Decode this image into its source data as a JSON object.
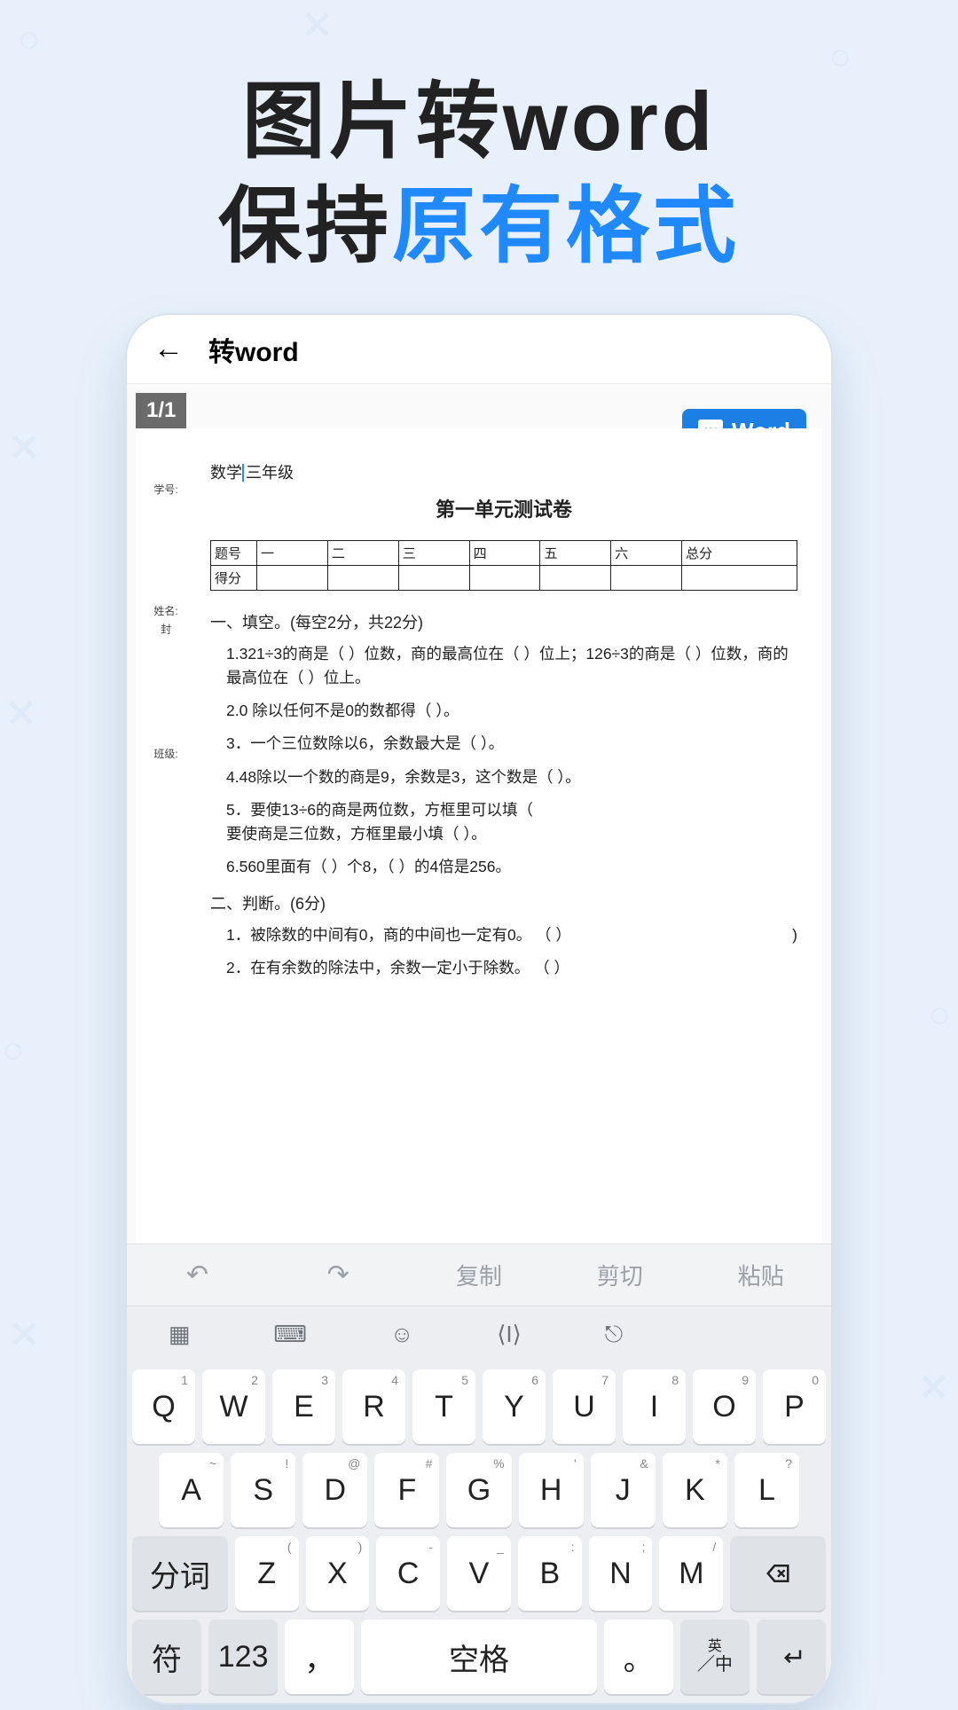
{
  "hero": {
    "line1": "图片转word",
    "line2a": "保持",
    "line2b": "原有格式"
  },
  "app": {
    "title": "转word",
    "page_indicator": "1/1",
    "word_button": "Word"
  },
  "paper": {
    "side_labels": {
      "xuehao": "学号:",
      "xingming": "姓名:",
      "feng": "封",
      "banji": "班级:"
    },
    "subject_prefix": "数学",
    "subject_suffix": "三年级",
    "title": "第一单元测试卷",
    "table": {
      "row1": [
        "题号",
        "一",
        "二",
        "三",
        "四",
        "五",
        "六",
        "总分"
      ],
      "row2_label": "得分"
    },
    "section1": "一、填空。(每空2分，共22分)",
    "q": {
      "q1": "1.321÷3的商是（  ）位数，商的最高位在（  ）位上；126÷3的商是（  ）位数，商的最高位在（  ）位上。",
      "q2": "2.0 除以任何不是0的数都得（  ）。",
      "q3": "3．一个三位数除以6，余数最大是（  ）。",
      "q4": "4.48除以一个数的商是9，余数是3，这个数是（  ）。",
      "q5": "5．要使13÷6的商是两位数，方框里可以填（\n要使商是三位数，方框里最小填（  ）。",
      "q6": "6.560里面有（  ）个8，（  ）的4倍是256。"
    },
    "section2": "二、判断。(6分)",
    "j": {
      "j1": "1．被除数的中间有0，商的中间也一定有0。  （  ）",
      "j1_right": ")",
      "j2": "2．在有余数的除法中，余数一定小于除数。  （  ）"
    }
  },
  "editbar": {
    "copy": "复制",
    "cut": "剪切",
    "paste": "粘贴"
  },
  "keyboard": {
    "row1": [
      {
        "k": "Q",
        "s": "1"
      },
      {
        "k": "W",
        "s": "2"
      },
      {
        "k": "E",
        "s": "3"
      },
      {
        "k": "R",
        "s": "4"
      },
      {
        "k": "T",
        "s": "5"
      },
      {
        "k": "Y",
        "s": "6"
      },
      {
        "k": "U",
        "s": "7"
      },
      {
        "k": "I",
        "s": "8"
      },
      {
        "k": "O",
        "s": "9"
      },
      {
        "k": "P",
        "s": "0"
      }
    ],
    "row2": [
      {
        "k": "A",
        "s": "~"
      },
      {
        "k": "S",
        "s": "!"
      },
      {
        "k": "D",
        "s": "@"
      },
      {
        "k": "F",
        "s": "#"
      },
      {
        "k": "G",
        "s": "%"
      },
      {
        "k": "H",
        "s": "'"
      },
      {
        "k": "J",
        "s": "&"
      },
      {
        "k": "K",
        "s": "*"
      },
      {
        "k": "L",
        "s": "?"
      }
    ],
    "row3_left": "分词",
    "row3": [
      {
        "k": "Z",
        "s": "("
      },
      {
        "k": "X",
        "s": ")"
      },
      {
        "k": "C",
        "s": "-"
      },
      {
        "k": "V",
        "s": "_"
      },
      {
        "k": "B",
        "s": ":"
      },
      {
        "k": "N",
        "s": ";"
      },
      {
        "k": "M",
        "s": "/"
      }
    ],
    "row4": {
      "sym": "符",
      "num": "123",
      "comma": "，",
      "space": "空格",
      "period": "。",
      "lang_top": "英",
      "lang_bot": "中"
    }
  }
}
